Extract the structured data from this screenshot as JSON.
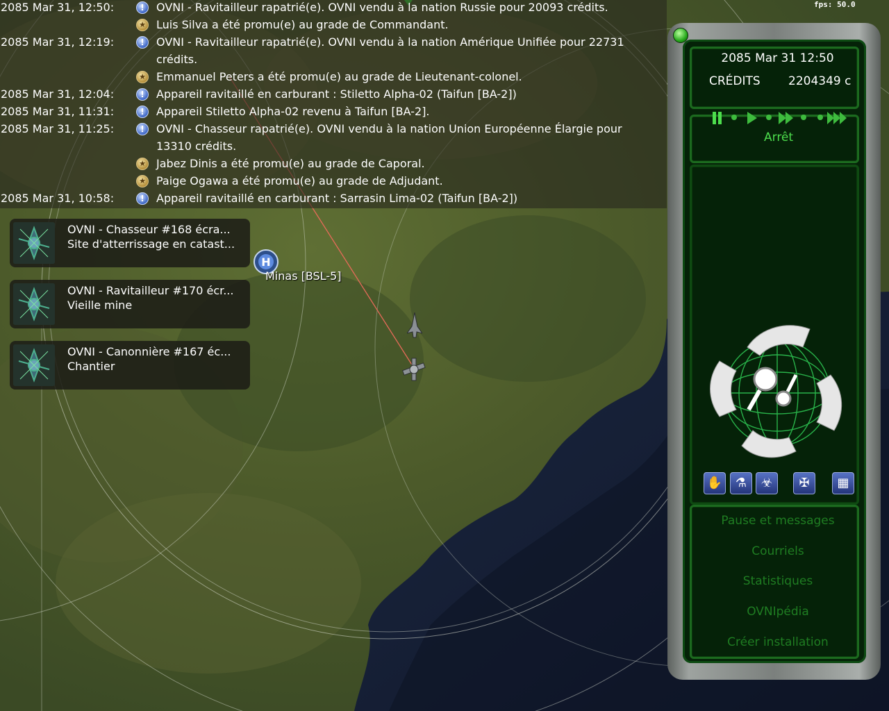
{
  "fps": "fps: 50.0",
  "log": [
    {
      "time": "2085 Mar 31, 12:50:",
      "icon": "info",
      "text": "OVNI - Ravitailleur rapatrié(e). OVNI vendu à la nation Russie pour 20093 crédits."
    },
    {
      "time": "",
      "icon": "promo",
      "text": "Luis Silva a été promu(e) au grade de Commandant."
    },
    {
      "time": "2085 Mar 31, 12:19:",
      "icon": "info",
      "text": "OVNI - Ravitailleur rapatrié(e). OVNI vendu à la nation Amérique Unifiée pour 22731"
    },
    {
      "time": "",
      "icon": "",
      "text": "crédits."
    },
    {
      "time": "",
      "icon": "promo",
      "text": "Emmanuel Peters a été promu(e) au grade de Lieutenant-colonel."
    },
    {
      "time": "2085 Mar 31, 12:04:",
      "icon": "info",
      "text": "Appareil ravitaillé en carburant : Stiletto Alpha-02 (Taifun [BA-2])"
    },
    {
      "time": "2085 Mar 31, 11:31:",
      "icon": "info",
      "text": "Appareil Stiletto Alpha-02 revenu à Taifun [BA-2]."
    },
    {
      "time": "2085 Mar 31, 11:25:",
      "icon": "info",
      "text": "OVNI - Chasseur rapatrié(e). OVNI vendu à la nation Union Européenne Élargie pour"
    },
    {
      "time": "",
      "icon": "",
      "text": "13310 crédits."
    },
    {
      "time": "",
      "icon": "promo",
      "text": "Jabez Dinis a été promu(e) au grade de Caporal."
    },
    {
      "time": "",
      "icon": "promo",
      "text": "Paige Ogawa a été promu(e) au grade de Adjudant."
    },
    {
      "time": "2085 Mar 31, 10:58:",
      "icon": "info",
      "text": "Appareil ravitaillé en carburant : Sarrasin Lima-02 (Taifun [BA-2])"
    }
  ],
  "sites": [
    {
      "title": "OVNI - Chasseur #168 écra...",
      "subtitle": "Site d'atterrissage en catast..."
    },
    {
      "title": "OVNI - Ravitailleur #170 écr...",
      "subtitle": "Vieille mine"
    },
    {
      "title": "OVNI - Canonnière #167 éc...",
      "subtitle": "Chantier"
    }
  ],
  "base": {
    "label": "Minas [BSL-5]"
  },
  "panel": {
    "date": "2085 Mar 31 12:50",
    "credits_label": "CRÉDITS",
    "credits_value": "2204349 c",
    "status": "Arrêt",
    "menu": [
      "Pause et messages",
      "Courriels",
      "Statistiques",
      "OVNIpédia",
      "Créer installation"
    ],
    "icons": [
      "hands-icon",
      "research-flask-icon",
      "biohazard-icon",
      "xcom-emblem-icon",
      "grid-icon"
    ]
  },
  "colors": {
    "panel_green": "#4dde4d",
    "menu_green": "#1f7d22",
    "log_bg": "#28281e"
  }
}
